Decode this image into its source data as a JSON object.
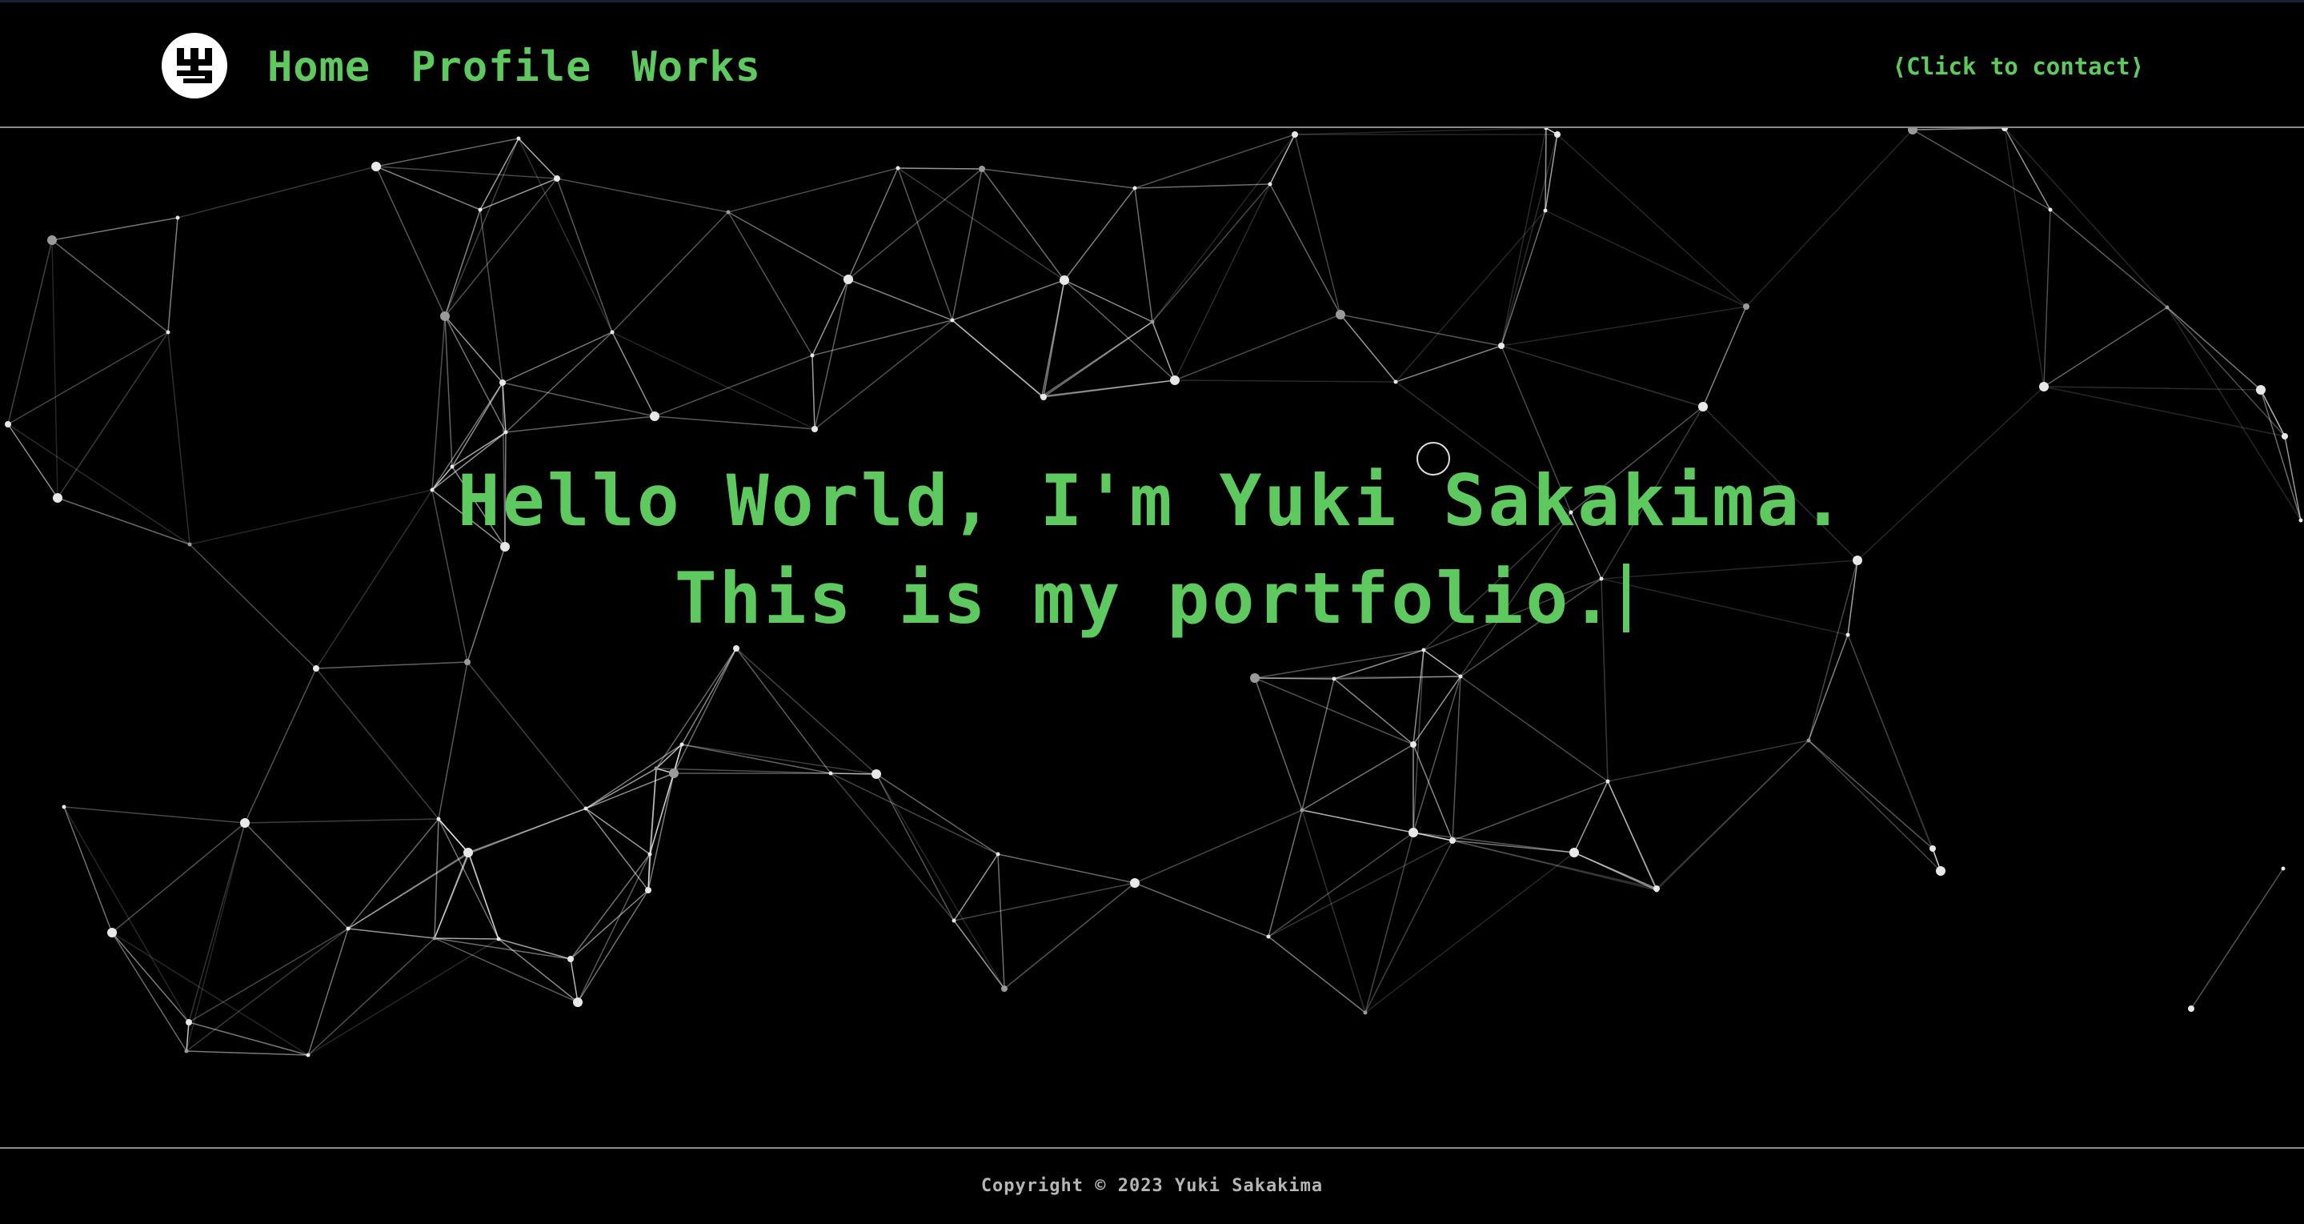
{
  "nav": {
    "links": [
      "Home",
      "Profile",
      "Works"
    ],
    "contact_label": "⟨Click to contact⟩"
  },
  "logo": {
    "icon": "yuki-monogram-icon"
  },
  "hero": {
    "line1": "Hello World, I'm Yuki Sakakima.",
    "line2": "This is my portfolio."
  },
  "footer": {
    "copyright": "Copyright © 2023 Yuki Sakakima"
  },
  "colors": {
    "accent": "#5ec95e",
    "background": "#000000",
    "divider": "#8a8a8a"
  }
}
